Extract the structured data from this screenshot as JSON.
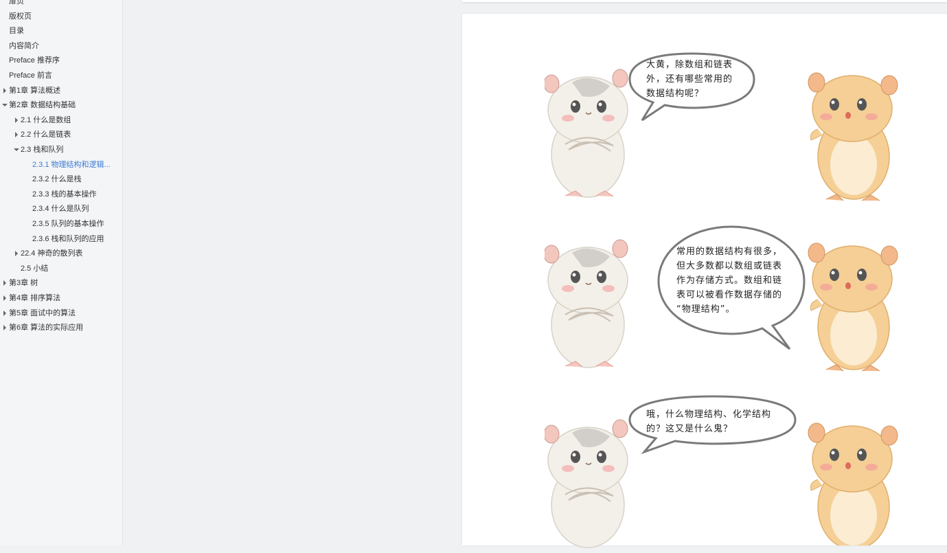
{
  "toc": {
    "items": [
      {
        "label": "扉页",
        "level": 0,
        "toggle": "none",
        "active": false
      },
      {
        "label": "版权页",
        "level": 0,
        "toggle": "none",
        "active": false
      },
      {
        "label": "目录",
        "level": 0,
        "toggle": "none",
        "active": false
      },
      {
        "label": "内容简介",
        "level": 0,
        "toggle": "none",
        "active": false
      },
      {
        "label": "Preface 推荐序",
        "level": 0,
        "toggle": "none",
        "active": false
      },
      {
        "label": "Preface 前言",
        "level": 0,
        "toggle": "none",
        "active": false
      },
      {
        "label": "第1章 算法概述",
        "level": 0,
        "toggle": "collapsed",
        "active": false
      },
      {
        "label": "第2章 数据结构基础",
        "level": 0,
        "toggle": "expanded",
        "active": false
      },
      {
        "label": "2.1 什么是数组",
        "level": 1,
        "toggle": "collapsed",
        "active": false
      },
      {
        "label": "2.2 什么是链表",
        "level": 1,
        "toggle": "collapsed",
        "active": false
      },
      {
        "label": "2.3 栈和队列",
        "level": 1,
        "toggle": "expanded",
        "active": false
      },
      {
        "label": "2.3.1 物理结构和逻辑...",
        "level": 2,
        "toggle": "none",
        "active": true
      },
      {
        "label": "2.3.2 什么是栈",
        "level": 2,
        "toggle": "none",
        "active": false
      },
      {
        "label": "2.3.3 栈的基本操作",
        "level": 2,
        "toggle": "none",
        "active": false
      },
      {
        "label": "2.3.4 什么是队列",
        "level": 2,
        "toggle": "none",
        "active": false
      },
      {
        "label": "2.3.5 队列的基本操作",
        "level": 2,
        "toggle": "none",
        "active": false
      },
      {
        "label": "2.3.6 栈和队列的应用",
        "level": 2,
        "toggle": "none",
        "active": false
      },
      {
        "label": "22.4 神奇的散列表",
        "level": 1,
        "toggle": "collapsed",
        "active": false
      },
      {
        "label": "2.5 小结",
        "level": 1,
        "toggle": "none",
        "active": false
      },
      {
        "label": "第3章 树",
        "level": 0,
        "toggle": "collapsed",
        "active": false
      },
      {
        "label": "第4章 排序算法",
        "level": 0,
        "toggle": "collapsed",
        "active": false
      },
      {
        "label": "第5章 面试中的算法",
        "level": 0,
        "toggle": "collapsed",
        "active": false
      },
      {
        "label": "第6章 算法的实际应用",
        "level": 0,
        "toggle": "collapsed",
        "active": false
      }
    ]
  },
  "dialogue": [
    {
      "lines": [
        "大黄，除数组和链表",
        "外，还有哪些常用的",
        "数据结构呢？"
      ]
    },
    {
      "lines": [
        "常用的数据结构有很多，",
        "但大多数都以数组或链表",
        "作为存储方式。数组和链",
        "表可以被看作数据存储的",
        "“物理结构”。"
      ]
    },
    {
      "lines": [
        "哦，什么物理结构、化学结构",
        "的？这又是什么鬼？"
      ]
    }
  ],
  "colors": {
    "accent": "#3b7bd6",
    "gray_hamster_body": "#f3efe9",
    "gray_hamster_patch": "#c9c6c0",
    "orange_hamster_body": "#f5cf95",
    "orange_hamster_belly": "#fbecd2",
    "bubble_stroke": "#7a7a7a"
  }
}
